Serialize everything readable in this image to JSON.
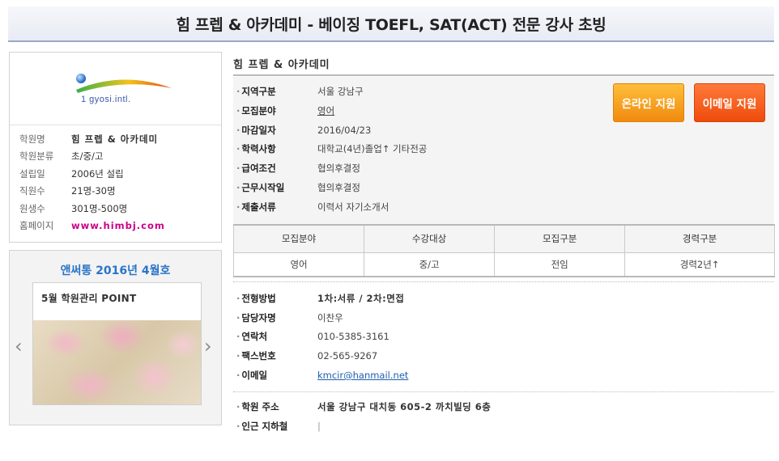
{
  "header": {
    "title": "힘 프렙 & 아카데미 - 베이징 TOEFL, SAT(ACT) 전문 강사 초빙"
  },
  "profile": {
    "logo_text": "1 gyosi.intl.",
    "rows": [
      {
        "label": "학원명",
        "value": "힘 프렙 & 아카데미"
      },
      {
        "label": "학원분류",
        "value": "초/중/고"
      },
      {
        "label": "설립일",
        "value": "2006년 설립"
      },
      {
        "label": "직원수",
        "value": "21명-30명"
      },
      {
        "label": "원생수",
        "value": "301명-500명"
      },
      {
        "label": "홈페이지",
        "value": "www.himbj.com"
      }
    ]
  },
  "magazine": {
    "title": "앤써통 2016년 4월호",
    "card_title": "5월 학원관리 POINT",
    "prev_icon": "‹",
    "next_icon": "›"
  },
  "main": {
    "academy_name": "힘 프렙 & 아카데미",
    "info": [
      {
        "label": "지역구분",
        "value": "서울 강남구"
      },
      {
        "label": "모집분야",
        "value": "영어"
      },
      {
        "label": "마감일자",
        "value": "2016/04/23"
      },
      {
        "label": "학력사항",
        "value": "대학교(4년)졸업↑ 기타전공"
      },
      {
        "label": "급여조건",
        "value": "협의후결정"
      },
      {
        "label": "근무시작일",
        "value": "협의후결정"
      },
      {
        "label": "제출서류",
        "value": "이력서  자기소개서"
      }
    ],
    "buttons": {
      "online_apply": "온라인 지원",
      "email_apply": "이메일 지원"
    },
    "table": {
      "headers": [
        "모집분야",
        "수강대상",
        "모집구분",
        "경력구분"
      ],
      "row": [
        "영어",
        "중/고",
        "전임",
        "경력2년↑"
      ]
    },
    "contact": [
      {
        "label": "전형방법",
        "value": "1차:서류  / 2차:면접"
      },
      {
        "label": "담당자명",
        "value": "이찬우"
      },
      {
        "label": "연락처",
        "value": "010-5385-3161"
      },
      {
        "label": "팩스번호",
        "value": "02-565-9267"
      },
      {
        "label": "이메일",
        "value": "kmcir@hanmail.net"
      }
    ],
    "address": [
      {
        "label": "학원 주소",
        "value": "서울 강남구 대치동 605-2 까치빌딩 6층"
      },
      {
        "label": "인근 지하철",
        "value": "|"
      }
    ]
  }
}
